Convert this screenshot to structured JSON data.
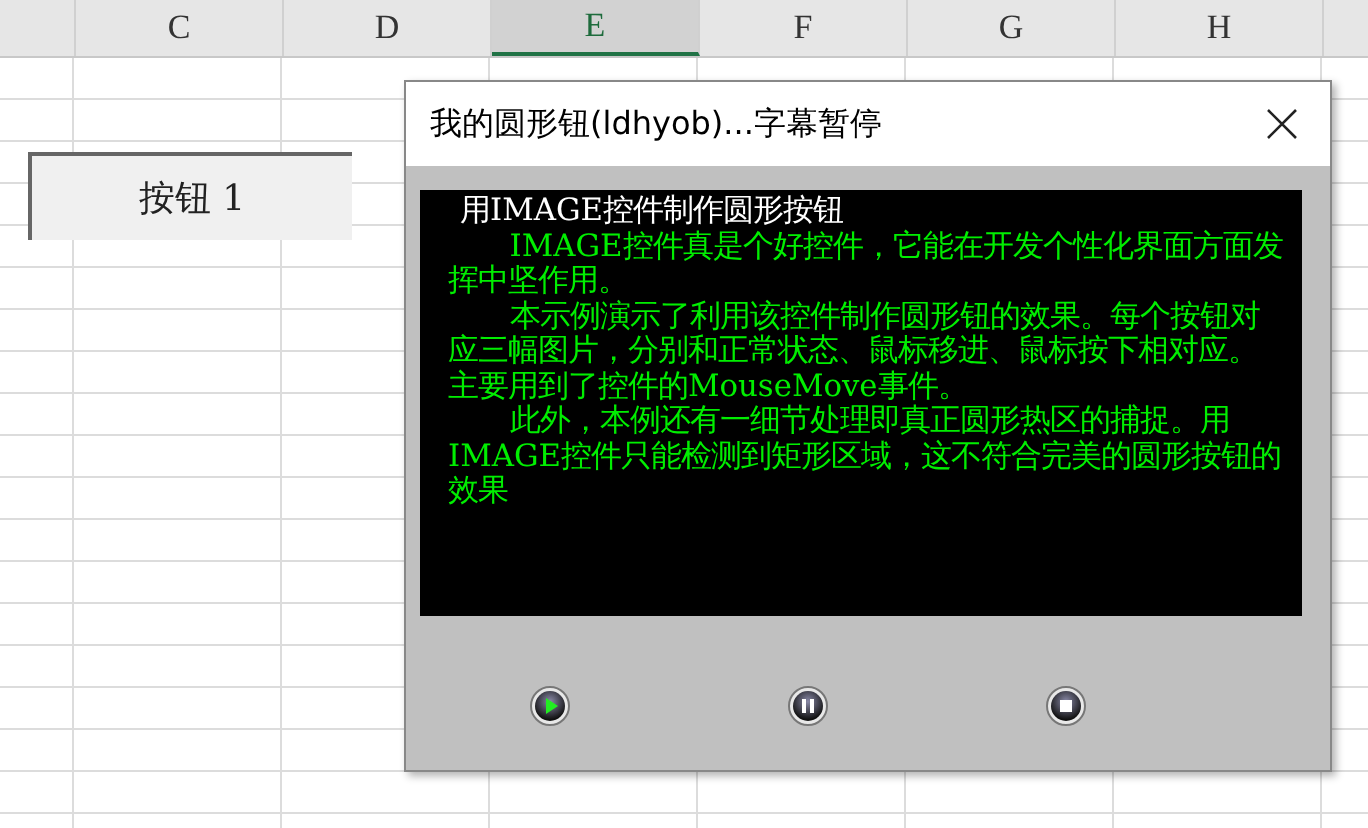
{
  "columns": [
    {
      "label": "C",
      "selected": false
    },
    {
      "label": "D",
      "selected": false
    },
    {
      "label": "E",
      "selected": true
    },
    {
      "label": "F",
      "selected": false
    },
    {
      "label": "G",
      "selected": false
    },
    {
      "label": "H",
      "selected": false
    }
  ],
  "sheet_button": {
    "label": "按钮 1"
  },
  "dialog": {
    "title": "我的圆形钮(ldhyob)...字幕暂停",
    "heading": "用IMAGE控件制作圆形按钮",
    "paragraphs": [
      "IMAGE控件真是个好控件，它能在开发个性化界面方面发挥中坚作用。",
      "本示例演示了利用该控件制作圆形钮的效果。每个按钮对应三幅图片，分别和正常状态、鼠标移进、鼠标按下相对应。主要用到了控件的MouseMove事件。",
      "此外，本例还有一细节处理即真正圆形热区的捕捉。用IMAGE控件只能检测到矩形区域，这不符合完美的圆形按钮的效果"
    ],
    "controls": [
      {
        "kind": "play"
      },
      {
        "kind": "pause"
      },
      {
        "kind": "stop"
      }
    ]
  }
}
